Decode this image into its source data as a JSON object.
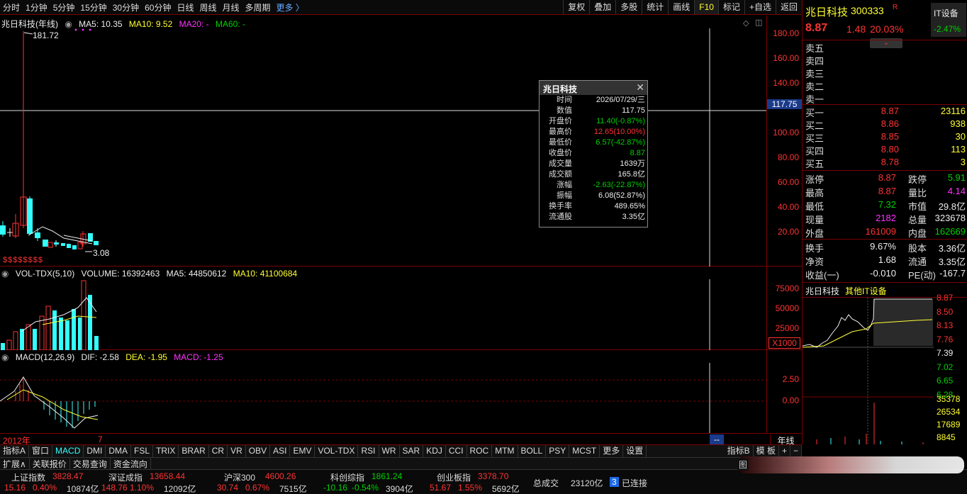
{
  "toolbar": {
    "periods": [
      "分时",
      "1分钟",
      "5分钟",
      "15分钟",
      "30分钟",
      "60分钟",
      "日线",
      "周线",
      "月线",
      "多周期"
    ],
    "more": "更多 〉",
    "actions": [
      "复权",
      "叠加",
      "多股",
      "统计",
      "画线",
      "F10",
      "标记",
      "+自选",
      "返回"
    ]
  },
  "kline": {
    "title": "兆日科技(年线)",
    "ma5": "MA5: 10.35",
    "ma10": "MA10: 9.52",
    "ma20": "MA20: -",
    "ma60": "MA60: -",
    "high_label": "181.72",
    "low_label": "3.08",
    "yticks": [
      "180.00",
      "160.00",
      "140.00",
      "117.75",
      "100.00",
      "80.00",
      "60.00",
      "40.00",
      "20.00"
    ],
    "marks": "$$$$$$$$"
  },
  "volume": {
    "title": "VOL-TDX(5,10)",
    "volume": "VOLUME: 16392463",
    "ma5": "MA5: 44850612",
    "ma10": "MA10: 41100684",
    "yticks": [
      "75000",
      "50000",
      "25000"
    ],
    "unit": "X1000"
  },
  "macd": {
    "title": "MACD(12,26,9)",
    "dif": "DIF: -2.58",
    "dea": "DEA: -1.95",
    "macd": "MACD: -1.25",
    "yticks": [
      "2.50",
      "0.00"
    ]
  },
  "xaxis": {
    "start": "2012年",
    "mark": "7",
    "cursor": "--",
    "period": "年线"
  },
  "tooltip": {
    "title": "兆日科技",
    "rows": [
      {
        "k": "时间",
        "v": "2026/07/29/三",
        "c": "white"
      },
      {
        "k": "数值",
        "v": "117.75",
        "c": "white"
      },
      {
        "k": "开盘价",
        "v": "11.40(-0.87%)",
        "c": "green"
      },
      {
        "k": "最高价",
        "v": "12.65(10.00%)",
        "c": "red"
      },
      {
        "k": "最低价",
        "v": "6.57(-42.87%)",
        "c": "green"
      },
      {
        "k": "收盘价",
        "v": "8.87",
        "c": "green"
      },
      {
        "k": "成交量",
        "v": "1639万",
        "c": "white"
      },
      {
        "k": "成交额",
        "v": "165.8亿",
        "c": "white"
      },
      {
        "k": "涨幅",
        "v": "-2.63(-22.87%)",
        "c": "green"
      },
      {
        "k": "振幅",
        "v": "6.08(52.87%)",
        "c": "white"
      },
      {
        "k": "换手率",
        "v": "489.65%",
        "c": "white"
      },
      {
        "k": "流通股",
        "v": "3.35亿",
        "c": "white"
      }
    ]
  },
  "tabs": [
    "指标A",
    "窗口",
    "MACD",
    "DMI",
    "DMA",
    "FSL",
    "TRIX",
    "BRAR",
    "CR",
    "VR",
    "OBV",
    "ASI",
    "EMV",
    "VOL-TDX",
    "RSI",
    "WR",
    "SAR",
    "KDJ",
    "CCI",
    "ROC",
    "MTM",
    "BOLL",
    "PSY",
    "MCST",
    "更多",
    "设置"
  ],
  "tabs_right": [
    "指标B",
    "模 板",
    "+",
    "−"
  ],
  "tabs2": [
    "扩展∧",
    "关联报价",
    "交易查询",
    "资金流向"
  ],
  "indices": [
    {
      "name": "上证指数",
      "value": "3828.47",
      "chg": "15.16",
      "pct": "0.40%",
      "amt": "10874亿",
      "dir": "red"
    },
    {
      "name": "深证成指",
      "value": "13658.44",
      "chg": "148.76",
      "pct": "1.10%",
      "amt": "12092亿",
      "dir": "red"
    },
    {
      "name": "沪深300",
      "value": "4600.26",
      "chg": "30.74",
      "pct": "0.67%",
      "amt": "7515亿",
      "dir": "red"
    },
    {
      "name": "科创综指",
      "value": "1861.24",
      "chg": "-10.16",
      "pct": "-0.54%",
      "amt": "3904亿",
      "dir": "green"
    },
    {
      "name": "创业板指",
      "value": "3378.70",
      "chg": "51.67",
      "pct": "1.55%",
      "amt": "5692亿",
      "dir": "red"
    }
  ],
  "status": {
    "total_label": "总成交",
    "total": "23120亿",
    "conn_count": "3",
    "conn": "已连接",
    "tu": "图"
  },
  "stock": {
    "name": "兆日科技",
    "code": "300333",
    "r_badge": "R",
    "sector": "IT设备",
    "sector_pct": "-2.47%",
    "price": "8.87",
    "chg": "1.48",
    "pct": "20.03%"
  },
  "asks": [
    {
      "label": "卖五",
      "price": "",
      "qty": ""
    },
    {
      "label": "卖四",
      "price": "",
      "qty": ""
    },
    {
      "label": "卖三",
      "price": "",
      "qty": ""
    },
    {
      "label": "卖二",
      "price": "",
      "qty": ""
    },
    {
      "label": "卖一",
      "price": "",
      "qty": ""
    }
  ],
  "bids": [
    {
      "label": "买一",
      "price": "8.87",
      "qty": "23116"
    },
    {
      "label": "买二",
      "price": "8.86",
      "qty": "938"
    },
    {
      "label": "买三",
      "price": "8.85",
      "qty": "30"
    },
    {
      "label": "买四",
      "price": "8.80",
      "qty": "113"
    },
    {
      "label": "买五",
      "price": "8.78",
      "qty": "3"
    }
  ],
  "stats": [
    [
      "涨停",
      "8.87",
      "red",
      "跌停",
      "5.91",
      "green"
    ],
    [
      "最高",
      "8.87",
      "red",
      "量比",
      "4.14",
      "magenta"
    ],
    [
      "最低",
      "7.32",
      "green",
      "市值",
      "29.8亿",
      "white"
    ],
    [
      "现量",
      "2182",
      "magenta",
      "总量",
      "323678",
      "white"
    ],
    [
      "外盘",
      "161009",
      "red",
      "内盘",
      "162669",
      "green"
    ]
  ],
  "stats2": [
    [
      "换手",
      "9.67%",
      "白",
      "股本",
      "3.36亿"
    ],
    [
      "净资",
      "1.68",
      "白",
      "流通",
      "3.35亿"
    ],
    [
      "收益(一)",
      "-0.010",
      "白",
      "PE(动)",
      "-167.7"
    ]
  ],
  "mini": {
    "name": "兆日科技",
    "sector": "其他IT设备",
    "prices": [
      "8.87",
      "8.50",
      "8.13",
      "7.76",
      "7.39",
      "7.02",
      "6.65",
      "6.28"
    ],
    "vols": [
      "35378",
      "26534",
      "17689",
      "8845"
    ]
  }
}
